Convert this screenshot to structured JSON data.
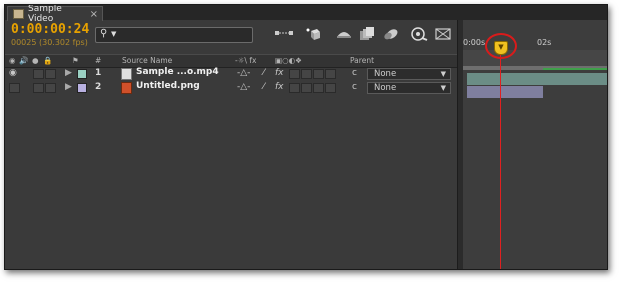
{
  "tab": {
    "title": "Sample Video",
    "close": "×"
  },
  "timecode": "0:00:00:24",
  "frame_info": "00025 (30.302 fps)",
  "search": {
    "placeholder": "",
    "icon": "search-icon"
  },
  "columns": {
    "number": "#",
    "source_name": "Source Name",
    "switches": "‑☼\\ fx",
    "parent": "Parent"
  },
  "layers": [
    {
      "number": "1",
      "source_name": "Sample ...o.mp4",
      "label_color": "#9ad0c2",
      "file_type": "video",
      "fx": "fx",
      "parent": "None"
    },
    {
      "number": "2",
      "source_name": "Untitled.png",
      "label_color": "#b8b0e0",
      "file_type": "image",
      "fx": "fx",
      "parent": "None"
    }
  ],
  "ruler": {
    "start": "0:00s",
    "mark": "02s"
  },
  "colors": {
    "timecode": "#e8a200",
    "playhead": "#e02020",
    "accent_circle": "#d91b1b"
  }
}
